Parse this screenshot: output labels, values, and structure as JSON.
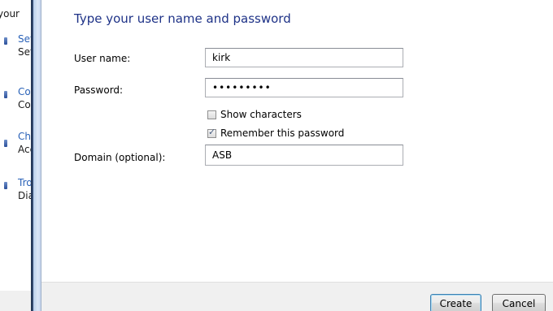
{
  "background_window": {
    "heading_fragment": "your",
    "items": [
      {
        "link": "Set",
        "sub": "Set"
      },
      {
        "link": "Co",
        "sub": "Cor"
      },
      {
        "link": "Ch",
        "sub": "Acc"
      },
      {
        "link": "Tro",
        "sub": "Dia"
      }
    ]
  },
  "dialog": {
    "title": "Type your user name and password",
    "fields": {
      "username": {
        "label": "User name:",
        "value": "kirk"
      },
      "password": {
        "label": "Password:",
        "value": "•••••••••"
      },
      "domain": {
        "label": "Domain (optional):",
        "value": "ASB"
      }
    },
    "checkboxes": {
      "show_characters": {
        "label": "Show characters",
        "checked": false
      },
      "remember_password": {
        "label": "Remember this password",
        "checked": true
      }
    },
    "buttons": {
      "create": "Create",
      "cancel": "Cancel"
    }
  }
}
